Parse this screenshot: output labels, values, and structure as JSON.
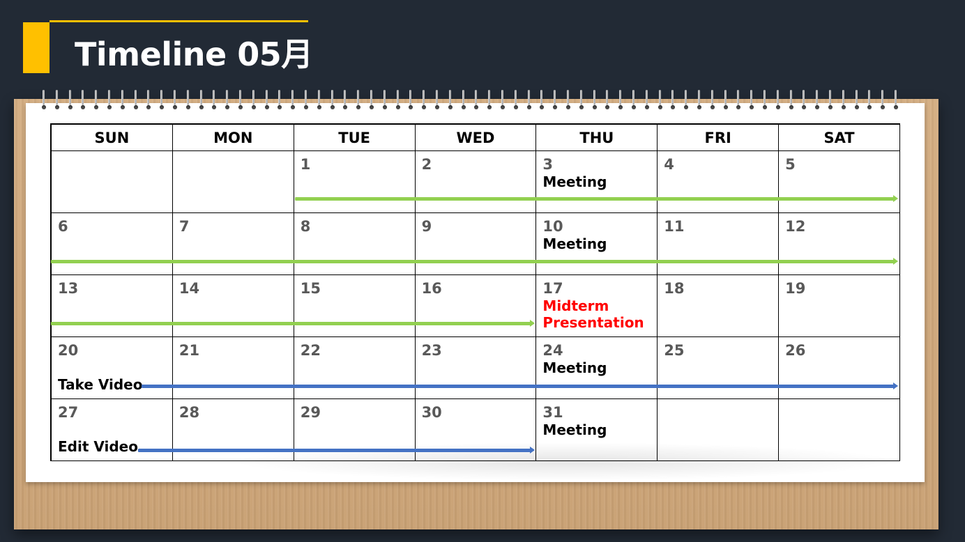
{
  "title": "Timeline 05月",
  "colors": {
    "background": "#222a35",
    "accent": "#ffc000",
    "progress_green": "#92d050",
    "video_blue": "#4472c4",
    "highlight_red": "#ff0000",
    "day_number": "#595959"
  },
  "calendar": {
    "weekdays": [
      "SUN",
      "MON",
      "TUE",
      "WED",
      "THU",
      "FRI",
      "SAT"
    ],
    "weeks": [
      [
        {
          "day": "",
          "event": ""
        },
        {
          "day": "",
          "event": ""
        },
        {
          "day": "1",
          "event": ""
        },
        {
          "day": "2",
          "event": ""
        },
        {
          "day": "3",
          "event": "Meeting"
        },
        {
          "day": "4",
          "event": ""
        },
        {
          "day": "5",
          "event": ""
        }
      ],
      [
        {
          "day": "6",
          "event": ""
        },
        {
          "day": "7",
          "event": ""
        },
        {
          "day": "8",
          "event": ""
        },
        {
          "day": "9",
          "event": ""
        },
        {
          "day": "10",
          "event": "Meeting"
        },
        {
          "day": "11",
          "event": ""
        },
        {
          "day": "12",
          "event": ""
        }
      ],
      [
        {
          "day": "13",
          "event": ""
        },
        {
          "day": "14",
          "event": ""
        },
        {
          "day": "15",
          "event": ""
        },
        {
          "day": "16",
          "event": ""
        },
        {
          "day": "17",
          "event": "Midterm\nPresentation",
          "highlight": true
        },
        {
          "day": "18",
          "event": ""
        },
        {
          "day": "19",
          "event": ""
        }
      ],
      [
        {
          "day": "20",
          "event": ""
        },
        {
          "day": "21",
          "event": ""
        },
        {
          "day": "22",
          "event": ""
        },
        {
          "day": "23",
          "event": ""
        },
        {
          "day": "24",
          "event": "Meeting"
        },
        {
          "day": "25",
          "event": ""
        },
        {
          "day": "26",
          "event": ""
        }
      ],
      [
        {
          "day": "27",
          "event": ""
        },
        {
          "day": "28",
          "event": ""
        },
        {
          "day": "29",
          "event": ""
        },
        {
          "day": "30",
          "event": ""
        },
        {
          "day": "31",
          "event": "Meeting"
        },
        {
          "day": "",
          "event": ""
        },
        {
          "day": "",
          "event": ""
        }
      ]
    ]
  },
  "tasks": [
    {
      "label": "Take Video",
      "color": "blue"
    },
    {
      "label": "Edit Video",
      "color": "blue"
    }
  ]
}
